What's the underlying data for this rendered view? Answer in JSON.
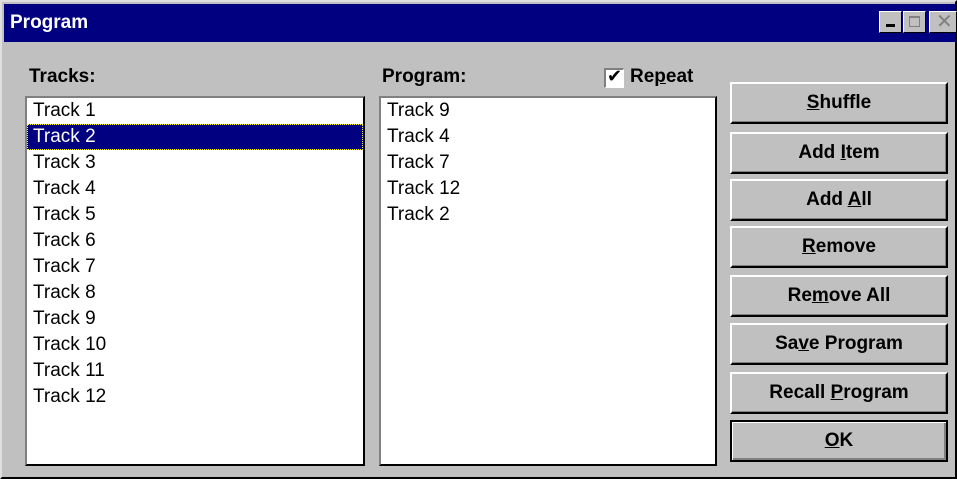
{
  "window": {
    "title": "Program"
  },
  "labels": {
    "tracks": "Tracks:",
    "program": "Program:"
  },
  "repeat": {
    "label_pre": "Re",
    "label_u": "p",
    "label_post": "eat",
    "checked": true
  },
  "tracks": {
    "items": [
      "Track 1",
      "Track 2",
      "Track 3",
      "Track 4",
      "Track 5",
      "Track 6",
      "Track 7",
      "Track 8",
      "Track 9",
      "Track 10",
      "Track 11",
      "Track 12"
    ],
    "selected_index": 1
  },
  "program": {
    "items": [
      "Track 9",
      "Track 4",
      "Track 7",
      "Track 12",
      "Track 2"
    ]
  },
  "buttons": {
    "shuffle": {
      "pre": "",
      "u": "S",
      "post": "huffle"
    },
    "add_item": {
      "pre": "Add ",
      "u": "I",
      "post": "tem"
    },
    "add_all": {
      "pre": "Add ",
      "u": "A",
      "post": "ll"
    },
    "remove": {
      "pre": "",
      "u": "R",
      "post": "emove"
    },
    "remove_all": {
      "pre": "Re",
      "u": "m",
      "post": "ove All"
    },
    "save_program": {
      "pre": "Sa",
      "u": "v",
      "post": "e Program"
    },
    "recall_program": {
      "pre": "Recall ",
      "u": "P",
      "post": "rogram"
    },
    "ok": {
      "pre": "",
      "u": "O",
      "post": "K"
    }
  },
  "colors": {
    "titlebar": "#000080",
    "face": "#c0c0c0",
    "selection": "#000080"
  }
}
